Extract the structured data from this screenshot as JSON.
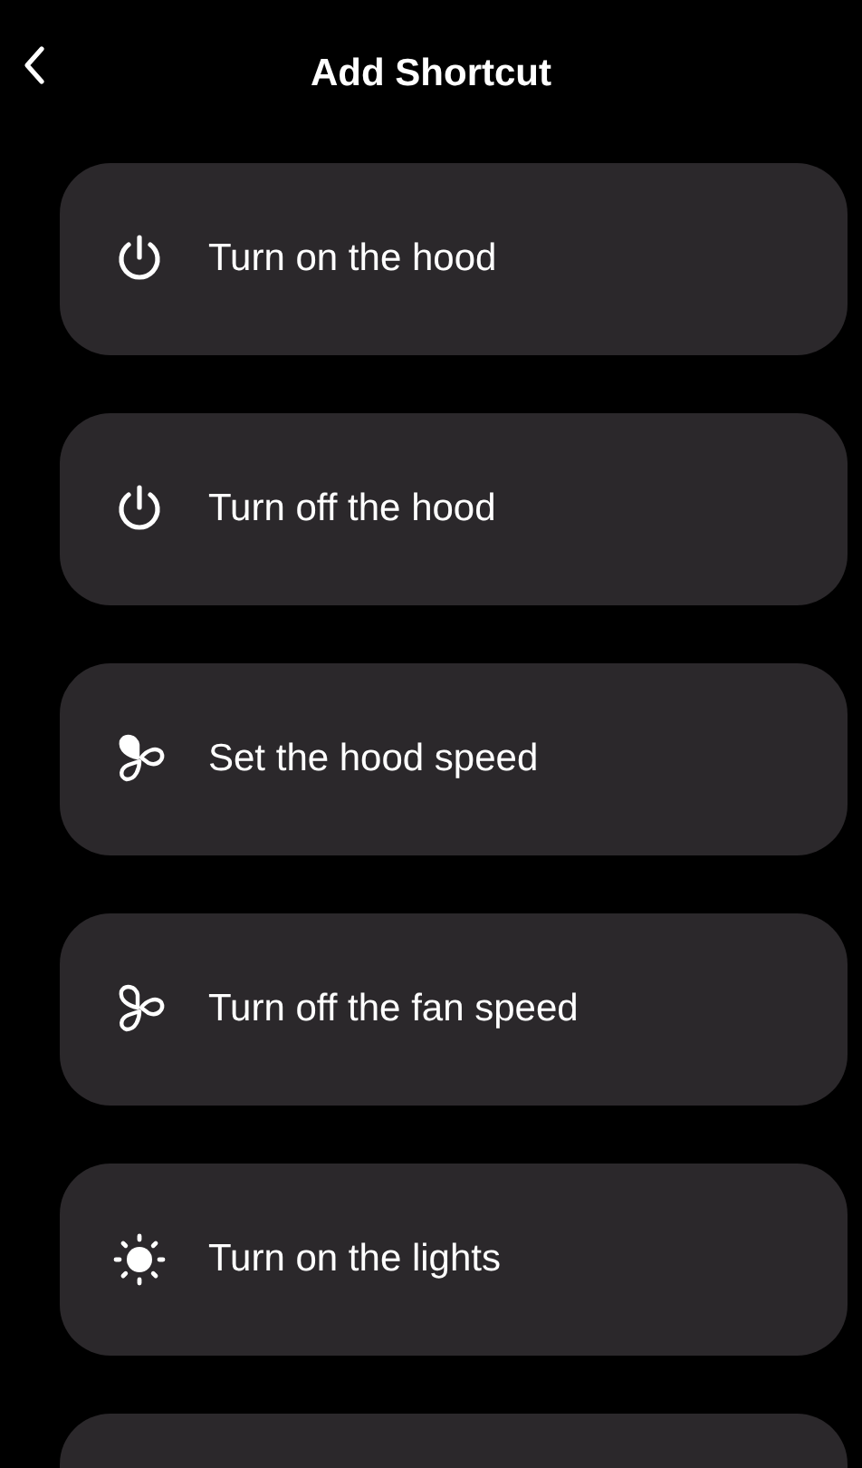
{
  "header": {
    "title": "Add Shortcut"
  },
  "shortcuts": [
    {
      "kind": "power",
      "label": "Turn on the hood"
    },
    {
      "kind": "power",
      "label": "Turn off the hood"
    },
    {
      "kind": "fan-speed",
      "label": "Set the hood speed"
    },
    {
      "kind": "fan",
      "label": "Turn off the fan speed"
    },
    {
      "kind": "light",
      "label": "Turn on the lights"
    }
  ]
}
